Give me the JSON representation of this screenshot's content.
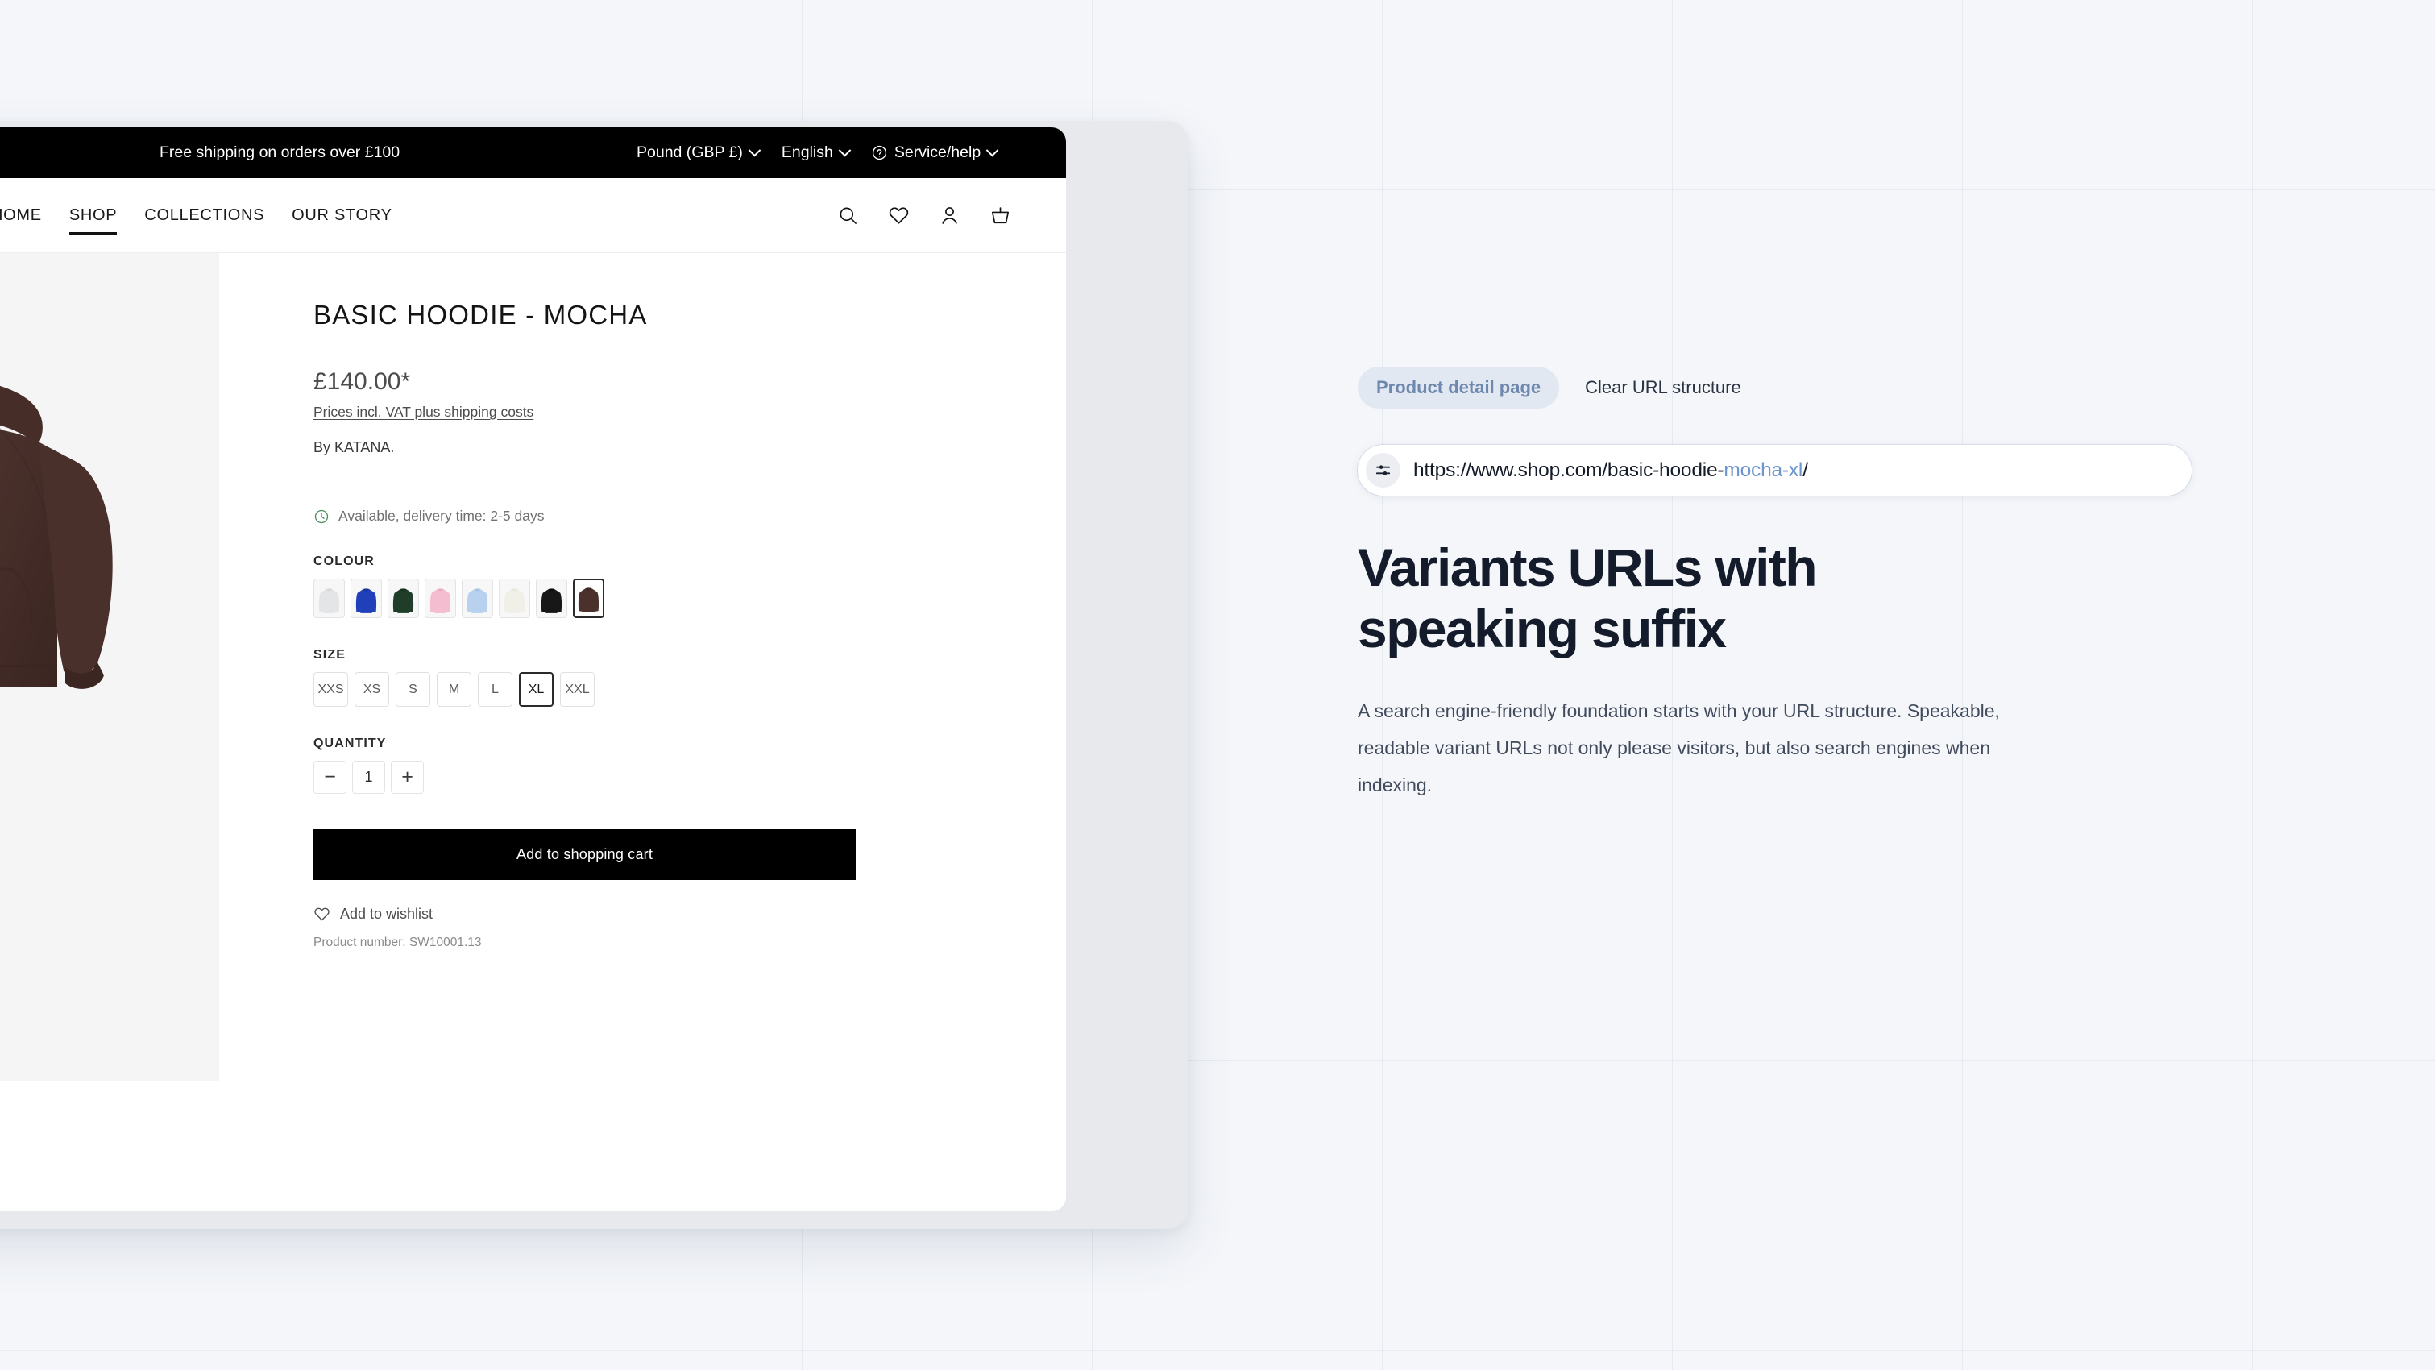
{
  "shop": {
    "utility_bar": {
      "logo_fragment": ".",
      "shipping_link": "Free shipping",
      "shipping_rest": " on orders over £100",
      "currency": "Pound (GBP £)",
      "language": "English",
      "service": "Service/help"
    },
    "nav": {
      "links": [
        {
          "label": "HOME",
          "active": false
        },
        {
          "label": "SHOP",
          "active": true
        },
        {
          "label": "COLLECTIONS",
          "active": false
        },
        {
          "label": "OUR STORY",
          "active": false
        }
      ],
      "icons": [
        "search-icon",
        "wishlist-heart-icon",
        "account-icon",
        "cart-basket-icon"
      ]
    },
    "product": {
      "title": "BASIC HOODIE - MOCHA",
      "price": "£140.00*",
      "vat_note": "Prices incl. VAT plus shipping costs",
      "by_prefix": "By ",
      "brand": "KATANA.",
      "availability": "Available, delivery time: 2-5 days",
      "colour_label": "COLOUR",
      "colours": [
        {
          "name": "Light Grey",
          "hex": "#e3e5e7",
          "selected": false
        },
        {
          "name": "Royal Blue",
          "hex": "#1f40b8",
          "selected": false
        },
        {
          "name": "Dark Green",
          "hex": "#1f3d29",
          "selected": false
        },
        {
          "name": "Pink",
          "hex": "#f4bdd0",
          "selected": false
        },
        {
          "name": "Light Blue",
          "hex": "#b7d1ee",
          "selected": false
        },
        {
          "name": "Cream",
          "hex": "#f1f0e8",
          "selected": false
        },
        {
          "name": "Black",
          "hex": "#171717",
          "selected": false
        },
        {
          "name": "Mocha",
          "hex": "#4b312c",
          "selected": true
        }
      ],
      "size_label": "SIZE",
      "sizes": [
        {
          "label": "XXS",
          "selected": false
        },
        {
          "label": "XS",
          "selected": false
        },
        {
          "label": "S",
          "selected": false
        },
        {
          "label": "M",
          "selected": false
        },
        {
          "label": "L",
          "selected": false
        },
        {
          "label": "XL",
          "selected": true
        },
        {
          "label": "XXL",
          "selected": false
        }
      ],
      "quantity_label": "QUANTITY",
      "quantity_value": "1",
      "decrease_symbol": "−",
      "increase_symbol": "+",
      "add_to_cart": "Add to shopping cart",
      "wishlist": "Add to wishlist",
      "product_number": "Product number: SW10001.13",
      "hoodie_colour_hex": "#4b312c",
      "gallery_bg_hex": "#f5f5f5"
    }
  },
  "panel": {
    "tabs": [
      {
        "label": "Product detail page",
        "active": true
      },
      {
        "label": "Clear URL structure",
        "active": false
      }
    ],
    "url": {
      "icon": "sliders-tune-icon",
      "base": "https://www.shop.com/basic-hoodie-",
      "suffix": "mocha-xl",
      "trailing": "/"
    },
    "headline_line1": "Variants URLs with",
    "headline_line2": "speaking suffix",
    "body": "A search engine-friendly foundation starts with your URL structure. Speakable, readable variant URLs not only please visitors, but also search engines when indexing."
  },
  "colors": {
    "page_bg": "#f4f6fa",
    "accent_blue": "#6d95d0",
    "tab_pill_bg": "#e2e8f2",
    "tab_pill_text": "#6f88ad",
    "headline": "#141c2b",
    "body_text": "#414b5c",
    "utility_bar": "#000000"
  }
}
